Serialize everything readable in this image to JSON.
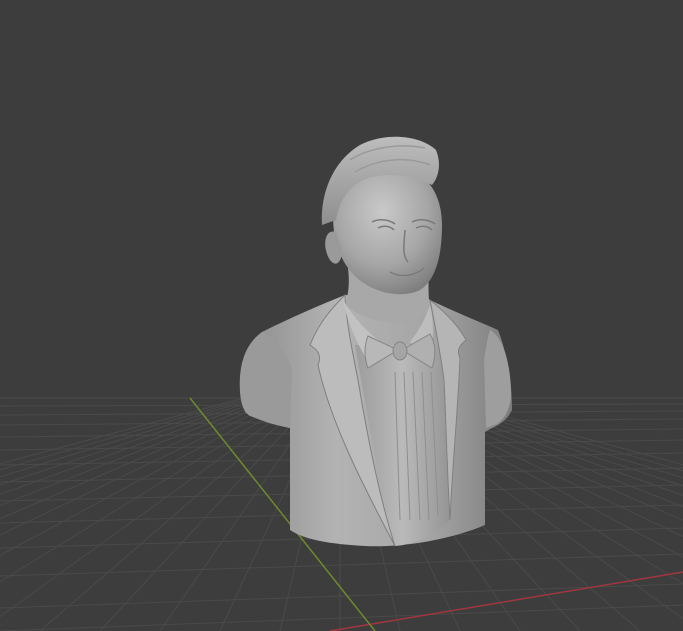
{
  "viewport": {
    "background": "#3d3d3d",
    "grid_color": "#4a4a4a",
    "x_axis_color": "#a1363f",
    "y_axis_color": "#6d8a2c",
    "model_color": "#a9a9a9",
    "model_name": ""
  }
}
